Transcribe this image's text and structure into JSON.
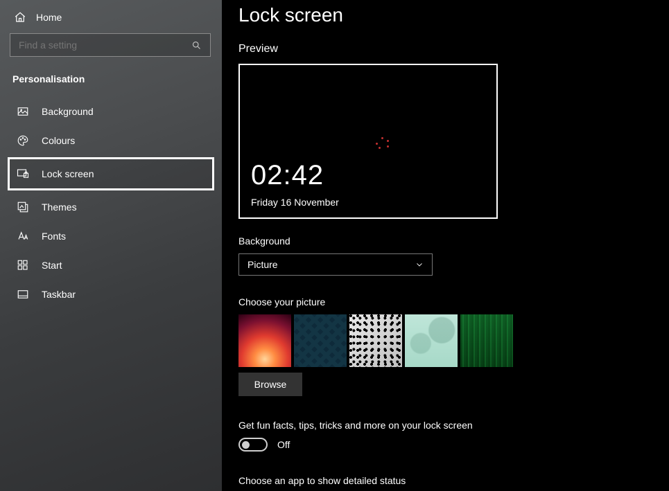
{
  "sidebar": {
    "home": "Home",
    "search_placeholder": "Find a setting",
    "section": "Personalisation",
    "items": [
      {
        "label": "Background"
      },
      {
        "label": "Colours"
      },
      {
        "label": "Lock screen"
      },
      {
        "label": "Themes"
      },
      {
        "label": "Fonts"
      },
      {
        "label": "Start"
      },
      {
        "label": "Taskbar"
      }
    ]
  },
  "main": {
    "title": "Lock screen",
    "preview_label": "Preview",
    "preview_time": "02:42",
    "preview_date": "Friday 16 November",
    "background_label": "Background",
    "background_value": "Picture",
    "choose_picture_label": "Choose your picture",
    "browse_label": "Browse",
    "fun_facts_label": "Get fun facts, tips, tricks and more on your lock screen",
    "fun_facts_state": "Off",
    "detailed_status_label": "Choose an app to show detailed status"
  }
}
